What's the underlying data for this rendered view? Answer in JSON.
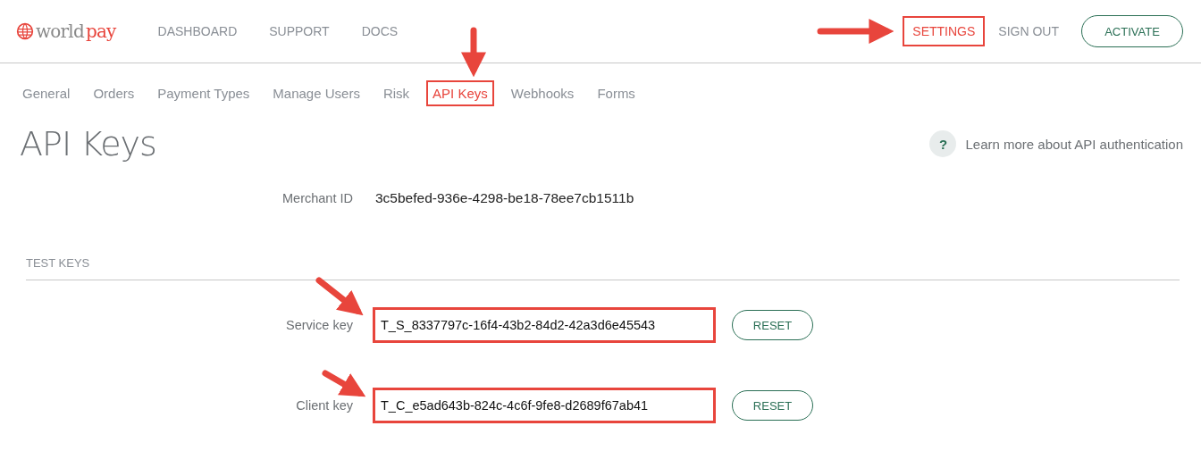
{
  "logo": {
    "primary": "world",
    "accent": "pay"
  },
  "top_nav": [
    {
      "label": "DASHBOARD",
      "highlighted": false
    },
    {
      "label": "SUPPORT",
      "highlighted": false
    },
    {
      "label": "DOCS",
      "highlighted": false
    }
  ],
  "account_nav": [
    {
      "label": "SETTINGS",
      "highlighted": true
    },
    {
      "label": "SIGN OUT",
      "highlighted": false
    }
  ],
  "activate_button": "ACTIVATE",
  "tabs": [
    {
      "label": "General",
      "selected": false,
      "highlighted": false
    },
    {
      "label": "Orders",
      "selected": false,
      "highlighted": false
    },
    {
      "label": "Payment Types",
      "selected": false,
      "highlighted": false
    },
    {
      "label": "Manage Users",
      "selected": false,
      "highlighted": false
    },
    {
      "label": "Risk",
      "selected": false,
      "highlighted": false
    },
    {
      "label": "API Keys",
      "selected": true,
      "highlighted": true
    },
    {
      "label": "Webhooks",
      "selected": false,
      "highlighted": false
    },
    {
      "label": "Forms",
      "selected": false,
      "highlighted": false
    }
  ],
  "page_title": "API Keys",
  "help_link": {
    "icon": "?",
    "label": "Learn more about API authentication"
  },
  "merchant": {
    "label": "Merchant ID",
    "value": "3c5befed-936e-4298-be18-78ee7cb1511b"
  },
  "test_keys": {
    "heading": "TEST KEYS",
    "keys": [
      {
        "label": "Service key",
        "value": "T_S_8337797c-16f4-43b2-84d2-42a3d6e45543",
        "highlighted": true,
        "button": "RESET"
      },
      {
        "label": "Client key",
        "value": "T_C_e5ad643b-824c-4c6f-9fe8-d2689f67ab41",
        "highlighted": true,
        "button": "RESET"
      }
    ]
  }
}
